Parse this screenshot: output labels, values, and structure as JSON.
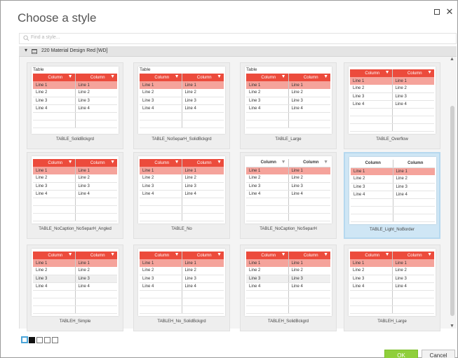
{
  "window": {
    "title": "Choose a style"
  },
  "search": {
    "placeholder": "Find a style..."
  },
  "group": {
    "label": "220 Material Design Red [WD]"
  },
  "common": {
    "table_caption": "Table",
    "column_label": "Column",
    "rows": [
      "Line 1",
      "Line 2",
      "Line 3",
      "Line 4"
    ]
  },
  "styles": [
    {
      "name": "TABLE_SolidBckgrd",
      "caption": true,
      "selected": false
    },
    {
      "name": "TABLE_NoSeparH_SolidBckgrd",
      "caption": true,
      "selected": false
    },
    {
      "name": "TABLE_Large",
      "caption": true,
      "selected": false
    },
    {
      "name": "TABLE_Overflow",
      "caption": false,
      "selected": false
    },
    {
      "name": "TABLE_NoCaption_NoSeparH_Angled",
      "caption": false,
      "selected": false
    },
    {
      "name": "TABLE_No",
      "caption": false,
      "selected": false
    },
    {
      "name": "TABLE_NoCaption_NoSeparH",
      "caption": false,
      "selected": false
    },
    {
      "name": "TABLE_Light_NoBorder",
      "caption": false,
      "selected": true
    },
    {
      "name": "TABLEH_Simple",
      "caption": false,
      "selected": false
    },
    {
      "name": "TABLEH_No_SolidBckgrd",
      "caption": false,
      "selected": false
    },
    {
      "name": "TABLEH_SolidBckgrd",
      "caption": false,
      "selected": false
    },
    {
      "name": "TABLEH_Large",
      "caption": false,
      "selected": false
    }
  ],
  "pager": {
    "pages": 5,
    "active": 1
  },
  "buttons": {
    "ok": "OK",
    "cancel": "Cancel"
  },
  "colors": {
    "accent": "#ec4b3c",
    "highlight_row": "#f5a39b",
    "selected_tile": "#cfe6f5",
    "ok_button": "#8fcf3b"
  }
}
